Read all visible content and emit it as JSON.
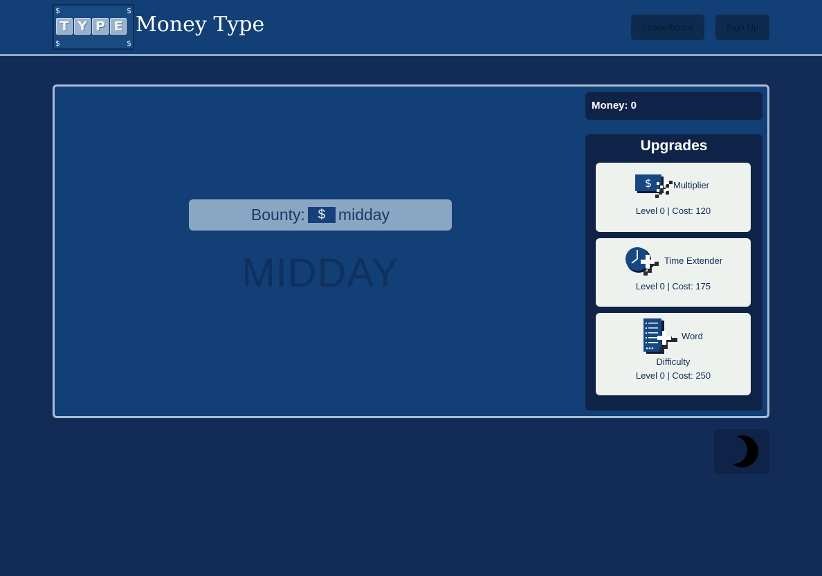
{
  "header": {
    "brand": "Money Type",
    "logo_tiles": [
      "T",
      "Y",
      "P",
      "E"
    ],
    "logo_dollar": "$",
    "nav": {
      "leaderboard": "Leaderboard",
      "signup": "Sign Up"
    }
  },
  "game": {
    "bounty_label": "Bounty:",
    "bounty_symbol": "$",
    "bounty_word": "midday",
    "target_word": "MIDDAY"
  },
  "sidebar": {
    "money": "Money: 0",
    "upgrades_title": "Upgrades",
    "upgrades": [
      {
        "name": "Multiplier",
        "stats": "Level 0 | Cost: 120",
        "icon": "money-multiplier-icon"
      },
      {
        "name": "Time Extender",
        "stats": "Level 0 | Cost: 175",
        "icon": "clock-plus-icon"
      },
      {
        "name_line1": "Word",
        "name_line2": "Difficulty",
        "stats": "Level 0 | Cost: 250",
        "icon": "word-list-plus-icon"
      }
    ]
  },
  "theme_toggle": {
    "icon": "moon-icon"
  },
  "colors": {
    "page_bg": "#132c57",
    "header_bg": "#123f76",
    "panel_bg": "#0e2347",
    "card_bg": "#eef2ee",
    "bounty_bg": "#8aa6c3"
  }
}
